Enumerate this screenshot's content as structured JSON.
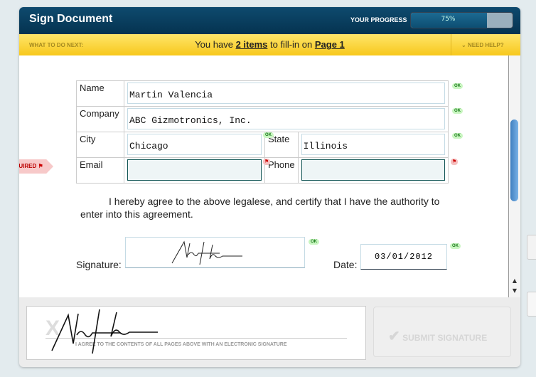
{
  "header": {
    "title": "Sign Document",
    "progress_label": "YOUR PROGRESS",
    "progress_percent": 75,
    "progress_text": "75%"
  },
  "next_bar": {
    "label": "WHAT TO DO NEXT:",
    "msg_prefix": "You have ",
    "items_link": "2 items",
    "msg_mid": " to fill-in on ",
    "page_link": "Page 1",
    "help": "NEED HELP?"
  },
  "form": {
    "name_label": "Name",
    "name_value": "Martin Valencia",
    "company_label": "Company",
    "company_value": "ABC Gizmotronics, Inc.",
    "city_label": "City",
    "city_value": "Chicago",
    "state_label": "State",
    "state_value": "Illinois",
    "email_label": "Email",
    "email_value": "",
    "phone_label": "Phone",
    "phone_value": "",
    "ok": "OK",
    "required": "REQUIRED"
  },
  "agreement": "I hereby agree to the above legalese, and certify that I have the authority to enter into this agreement.",
  "signature_label": "Signature:",
  "date_label": "Date:",
  "date_value": "03/01/2012",
  "sign_panel": {
    "x_mark": "X",
    "caption": "I AGREE TO THE CONTENTS OF ALL PAGES ABOVE WITH AN ELECTRONIC SIGNATURE",
    "submit": "SUBMIT SIGNATURE"
  },
  "colors": {
    "header": "#0e4a6e",
    "bar": "#f7c81c",
    "ok": "#c9f6c1",
    "required": "#f7c9c9"
  }
}
